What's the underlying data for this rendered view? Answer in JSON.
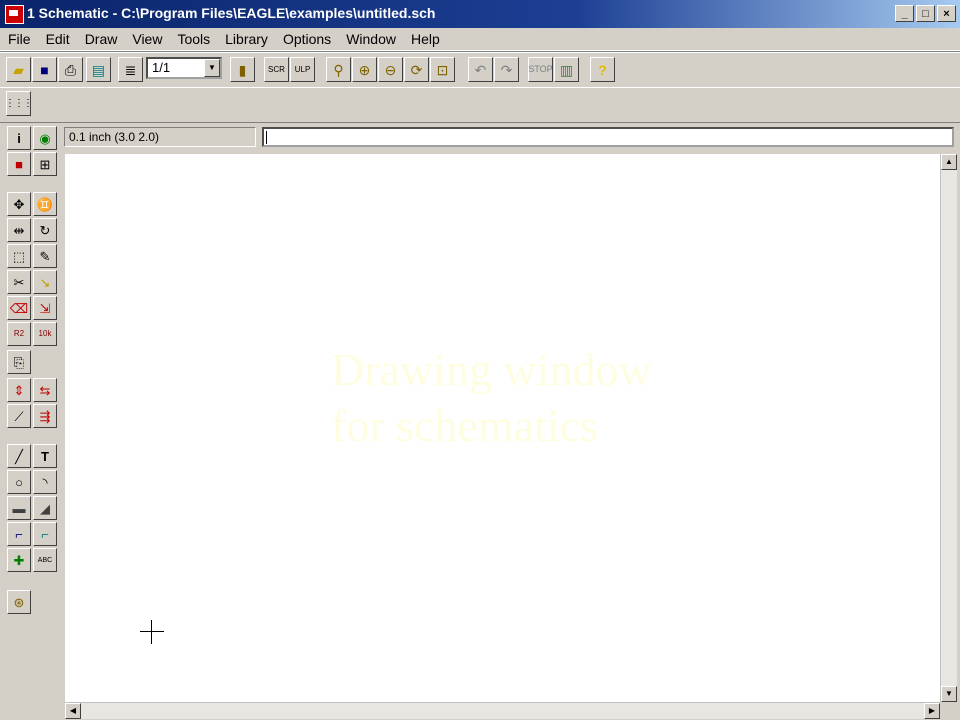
{
  "window": {
    "title": "1 Schematic - C:\\Program Files\\EAGLE\\examples\\untitled.sch",
    "controls": [
      "_",
      "□",
      "×"
    ]
  },
  "menu": [
    "File",
    "Edit",
    "Draw",
    "View",
    "Tools",
    "Library",
    "Options",
    "Window",
    "Help"
  ],
  "toolbar": {
    "sheet_select": "1/1"
  },
  "status": {
    "grid_readout": "0.1 inch (3.0 2.0)",
    "command_line": ""
  },
  "canvas": {
    "annotation": "Drawing window\nfor schematics",
    "background": "#ffffff",
    "annotation_color": "#fffde0"
  },
  "icons": {
    "toolbar_main": [
      "open-icon",
      "save-icon",
      "print-icon",
      "cam-icon",
      "sheet-icon",
      "use-library-icon",
      "script-icon",
      "ulp-icon",
      "zoom-fit-icon",
      "zoom-in-icon",
      "zoom-out-icon",
      "zoom-redraw-icon",
      "zoom-select-icon",
      "undo-icon",
      "redo-icon",
      "stop-icon",
      "go-icon",
      "help-icon"
    ],
    "toolbar_param": [
      "grid-icon"
    ],
    "tools_left": [
      "info-icon",
      "show-icon",
      "display-icon",
      "mark-icon",
      "move-icon",
      "copy-icon",
      "mirror-icon",
      "rotate-icon",
      "group-icon",
      "change-icon",
      "cut-icon",
      "paste-icon",
      "delete-icon",
      "add-icon",
      "name-icon",
      "value-icon",
      "smash-icon",
      "pinswap-icon",
      "gateswap-icon",
      "split-icon",
      "invoke-icon",
      "wire-icon",
      "text-icon",
      "circle-icon",
      "arc-icon",
      "rect-icon",
      "polygon-icon",
      "bus-icon",
      "net-icon",
      "junction-icon",
      "label-icon",
      "erc-icon"
    ]
  }
}
